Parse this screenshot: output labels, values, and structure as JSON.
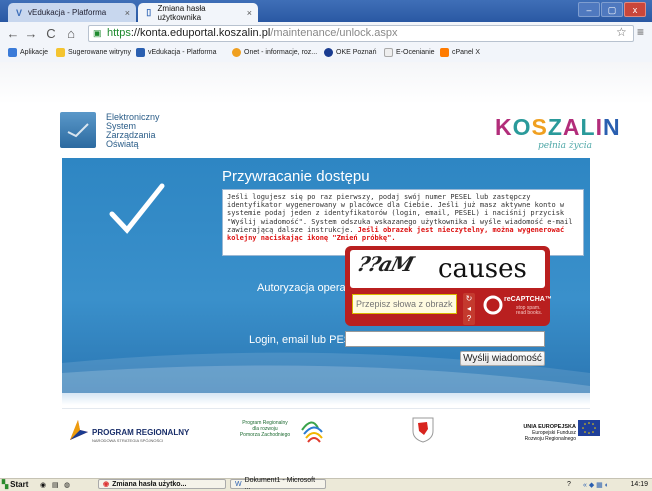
{
  "browser": {
    "tabs": [
      {
        "icon": "V",
        "label": "vEdukacja - Platforma"
      },
      {
        "icon": "page-icon",
        "label": "Zmiana hasła użytkownika"
      }
    ],
    "window_buttons": [
      "–",
      "▢",
      "x"
    ],
    "url": {
      "scheme": "https",
      "host": "://konta.eduportal.koszalin.pl",
      "path": "/maintenance/unlock.aspx"
    },
    "bookmarks": [
      {
        "label": "Aplikacje",
        "color": "#3b7bd8"
      },
      {
        "label": "Sugerowane witryny",
        "color": "#f4c430"
      },
      {
        "label": "vEdukacja - Platforma",
        "color": "#2a5fb0"
      },
      {
        "label": "Onet - informacje, roz...",
        "color": "#f0a020"
      },
      {
        "label": "OKE Poznań",
        "color": "#1a3c90"
      },
      {
        "label": "E-Ocenianie",
        "color": "#eeeeee"
      },
      {
        "label": "cPanel X",
        "color": "#ff7b00"
      }
    ]
  },
  "header": {
    "sep_logo_lines": [
      "Elektroniczny",
      "System",
      "Zarządzania",
      "Oświatą"
    ],
    "city_logo": "KOSZALIN",
    "city_slogan": "pełnia życia"
  },
  "form": {
    "title": "Przywracanie dostępu",
    "info_text": "Jeśli logujesz się po raz pierwszy, podaj swój numer PESEL lub zastępczy identyfikator wygenerowany w placówce dla Ciebie. Jeśli już masz aktywne konto w systemie podaj jeden z identyfikatorów (login, email, PESEL) i naciśnij przycisk \"Wyślij wiadomość\". System odszuka wskazanego użytkownika i wyśle wiadomość e-mail zawierającą dalsze instrukcje.",
    "warning_text": "Jeśli obrazek jest nieczytelny, można wygenerować kolejny naciskając ikonę \"Zmień próbkę\".",
    "auth_label": "Autoryzacja operacji:",
    "captcha_word1": "??aM",
    "captcha_word2": "causes",
    "captcha_placeholder": "Przepisz słowa z obrazka",
    "captcha_logo": "reCAPTCHA™",
    "captcha_logo_sub": "stop spam.\nread books.",
    "login_label": "Login, email lub PESEL:",
    "login_value": "",
    "send_button": "Wyślij wiadomość"
  },
  "footer": {
    "program_regionalny": "PROGRAM REGIONALNY",
    "program_regionalny_sub": "NARODOWA STRATEGIA SPÓJNOŚCI",
    "program_regionalny_2": "Program Regionalny\ndla rozwoju\nPomorza Zachodniego",
    "ue_title": "UNIA EUROPEJSKA",
    "ue_sub": "Europejski Fundusz\nRozwoju Regionalnego"
  },
  "taskbar": {
    "start": "Start",
    "tasks": [
      "Zmiana hasła użytko...",
      "Dokument1 - Microsoft ..."
    ],
    "clock": "14:19"
  }
}
